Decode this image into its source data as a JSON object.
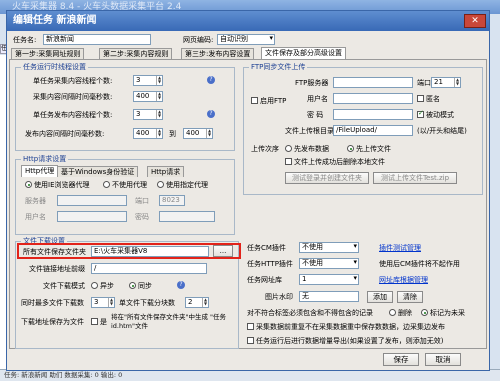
{
  "app": {
    "title": "火车采集器 8.4 - 火车头数据采集平台 2.4",
    "status_text": "任务: 新浪新闻    助们    数据采集: 0    输出: 0",
    "left_tab": "任务名"
  },
  "dialog": {
    "title": "编辑任务  新浪新闻",
    "close": "✕",
    "task_name_label": "任务名:",
    "task_name": "新浪新闻",
    "encoding_label": "网页编码:",
    "encoding": "自动识别",
    "tabs": [
      "第一步:采集网址规则",
      "第二步:采集内容规则",
      "第三步:发布内容设置",
      "文件保存及部分高级设置"
    ],
    "run": {
      "title": "任务运行时线程设置",
      "collect_threads_label": "单任务采集内容线程个数:",
      "collect_threads": "3",
      "collect_interval_label": "采集内容间隔时间毫秒数:",
      "collect_interval": "400",
      "publish_threads_label": "单任务发布内容线程个数:",
      "publish_threads": "3",
      "publish_interval_label": "发布内容间隔时间毫秒数:",
      "publish_interval_from": "400",
      "to": "到",
      "publish_interval_to": "400"
    },
    "http": {
      "title": "Http请求设置",
      "tabs": [
        "Http代理",
        "基于Windows身份验证",
        "Http请求"
      ],
      "opt1": "使用IE浏览器代理",
      "opt2": "不使用代理",
      "opt3": "使用指定代理",
      "server_label": "服务器",
      "port_label": "端口",
      "port": "8023",
      "user_label": "用户名",
      "pass_label": "密码"
    },
    "download": {
      "title": "文件下载设置",
      "save_folder_label": "所有文件保存文件夹",
      "save_folder": "E:\\火车采集器V8",
      "browse": "...",
      "prefix_label": "文件链接地址前缀",
      "prefix": "/",
      "mode_label": "文件下载模式",
      "mode_async": "异步",
      "mode_sync": "同步",
      "concurrent_label": "同时最多文件下载数",
      "concurrent": "3",
      "threads_label": "单文件下载分块数",
      "threads": "2",
      "saveas_label": "下载地址保存为文件",
      "saveas_yes": "是",
      "saveas_note": "将在\"所有文件保存文件夹\"中生成 \"任务id.htm\"文件"
    },
    "ftp": {
      "title": "FTP同步文件上传",
      "enable": "启用FTP",
      "server_label": "FTP服务器",
      "port_label": "端口",
      "port": "21",
      "user_label": "用户名",
      "anon": "匿名",
      "pass_label": "密  码",
      "passive": "被动模式",
      "dir_label": "文件上传根目录",
      "dir": "/FileUpload/",
      "dir_hint": "(以/开头和结尾)",
      "order_label": "上传次序",
      "order1": "先发布数据",
      "order2": "先上传文件",
      "delete_after": "文件上传成功后删除本地文件",
      "test_login": "测试登录并创建文件夹",
      "test_upload": "测试上传文件Test.zip"
    },
    "plugins": {
      "cm_label": "任务CM插件",
      "cm_value": "不使用",
      "cm_link": "插件测试管理",
      "http_label": "任务HTTP插件",
      "http_value": "不使用",
      "http_note": "使用后CM插件将不起作用",
      "url_label": "任务网址库",
      "url_value": "1",
      "url_link": "网址库根据管理"
    },
    "watermark": {
      "label": "图片水印",
      "value": "无",
      "add": "添加",
      "clear": "清除"
    },
    "nodata": {
      "label": "对不符合标签必须包含和不得包含的记录",
      "opt1": "删除",
      "opt2": "标记为未采"
    },
    "check1": "采集数据前重复",
    "check1_rest": "不在采集数据重中保存数数据，边采集边发布",
    "check2": "任务运行后进行数据增量导出(如果设置了发布，则添加无效)",
    "save": "保存",
    "cancel": "取消"
  }
}
